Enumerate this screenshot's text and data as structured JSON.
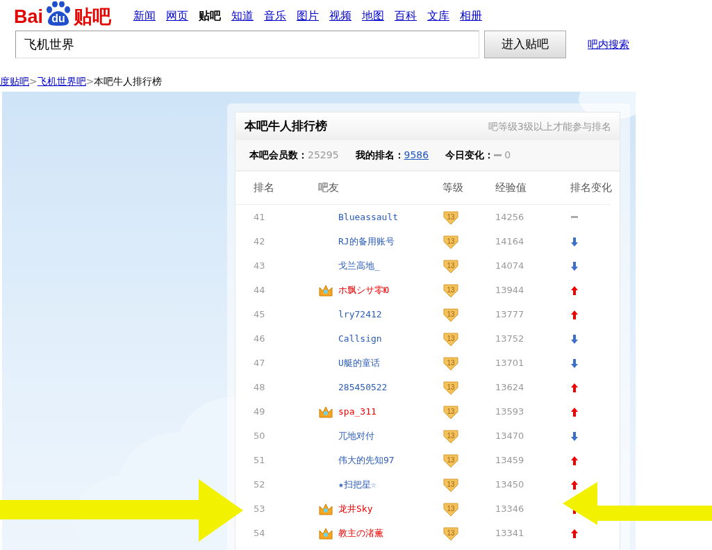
{
  "logo": {
    "left": "Bai",
    "paw": "du",
    "right": "贴吧"
  },
  "nav": [
    {
      "label": "新闻",
      "selected": false
    },
    {
      "label": "网页",
      "selected": false
    },
    {
      "label": "贴吧",
      "selected": true
    },
    {
      "label": "知道",
      "selected": false
    },
    {
      "label": "音乐",
      "selected": false
    },
    {
      "label": "图片",
      "selected": false
    },
    {
      "label": "视频",
      "selected": false
    },
    {
      "label": "地图",
      "selected": false
    },
    {
      "label": "百科",
      "selected": false
    },
    {
      "label": "文库",
      "selected": false
    },
    {
      "label": "相册",
      "selected": false
    }
  ],
  "search": {
    "value": "飞机世界",
    "button": "进入贴吧",
    "link": "吧内搜索"
  },
  "breadcrumb": [
    {
      "label": "度贴吧",
      "kind": "link"
    },
    {
      "label": ">",
      "kind": "separator"
    },
    {
      "label": "飞机世界吧",
      "kind": "link"
    },
    {
      "label": ">",
      "kind": "separator"
    },
    {
      "label": "本吧牛人排行榜",
      "kind": "current"
    }
  ],
  "panel": {
    "title": "本吧牛人排行榜",
    "note": "吧等级3级以上才能参与排名",
    "stats": [
      {
        "label": "本吧会员数：",
        "value": "25295",
        "kind": "plain"
      },
      {
        "label": "我的排名：",
        "value": "9586",
        "kind": "link"
      },
      {
        "label": "今日变化：",
        "value": "0",
        "kind": "same"
      }
    ],
    "columns": [
      "排名",
      "吧友",
      "等级",
      "经验值",
      "排名变化"
    ],
    "rows": [
      {
        "rank": "41",
        "name": "Blueassault",
        "vip": false,
        "level": "13",
        "exp": "14256",
        "kind": "same"
      },
      {
        "rank": "42",
        "name": "RJ的备用账号",
        "vip": false,
        "level": "13",
        "exp": "14164",
        "kind": "down"
      },
      {
        "rank": "43",
        "name": "戈兰高地_",
        "vip": false,
        "level": "13",
        "exp": "14074",
        "kind": "down"
      },
      {
        "rank": "44",
        "name": "ホ飘シサ零Ю",
        "vip": true,
        "level": "13",
        "exp": "13944",
        "kind": "up"
      },
      {
        "rank": "45",
        "name": "lry72412",
        "vip": false,
        "level": "13",
        "exp": "13777",
        "kind": "up"
      },
      {
        "rank": "46",
        "name": "Callsign",
        "vip": false,
        "level": "13",
        "exp": "13752",
        "kind": "down"
      },
      {
        "rank": "47",
        "name": "U艇的童话",
        "vip": false,
        "level": "13",
        "exp": "13701",
        "kind": "down"
      },
      {
        "rank": "48",
        "name": "285450522",
        "vip": false,
        "level": "13",
        "exp": "13624",
        "kind": "up"
      },
      {
        "rank": "49",
        "name": "spa_311",
        "vip": true,
        "level": "13",
        "exp": "13593",
        "kind": "up"
      },
      {
        "rank": "50",
        "name": "兀地对付",
        "vip": false,
        "level": "13",
        "exp": "13470",
        "kind": "down"
      },
      {
        "rank": "51",
        "name": "伟大的先知97",
        "vip": false,
        "level": "13",
        "exp": "13459",
        "kind": "up"
      },
      {
        "rank": "52",
        "name": "★扫把星☆",
        "vip": false,
        "level": "13",
        "exp": "13450",
        "kind": "up"
      },
      {
        "rank": "53",
        "name": "龙井Sky",
        "vip": true,
        "level": "13",
        "exp": "13346",
        "kind": "up"
      },
      {
        "rank": "54",
        "name": "教主の渚薫",
        "vip": true,
        "level": "13",
        "exp": "13341",
        "kind": "up"
      }
    ]
  }
}
